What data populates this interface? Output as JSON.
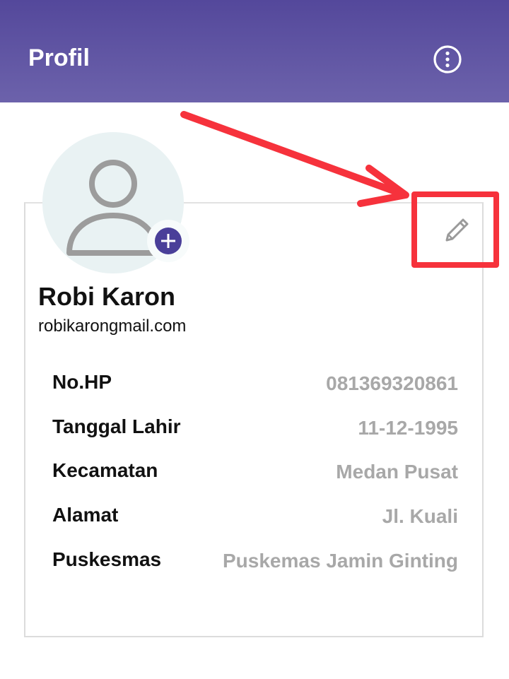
{
  "app_bar": {
    "title": "Profil",
    "menu_icon": "more-vertical-icon",
    "color_top": "#54489b",
    "color_bottom": "#6c62ab"
  },
  "profile": {
    "avatar_icon": "person-icon",
    "add_photo_icon": "plus-icon",
    "edit_icon": "pencil-icon",
    "name": "Robi Karon",
    "email": "robikarongmail.com"
  },
  "details": [
    {
      "label": "No.HP",
      "value": "081369320861"
    },
    {
      "label": "Tanggal Lahir",
      "value": "11-12-1995"
    },
    {
      "label": "Kecamatan",
      "value": "Medan Pusat"
    },
    {
      "label": "Alamat",
      "value": "Jl. Kuali"
    },
    {
      "label": "Puskesmas",
      "value": "Puskemas Jamin Ginting"
    }
  ],
  "annotation": {
    "color": "#f6323c",
    "arrow_icon": "arrow-icon"
  }
}
